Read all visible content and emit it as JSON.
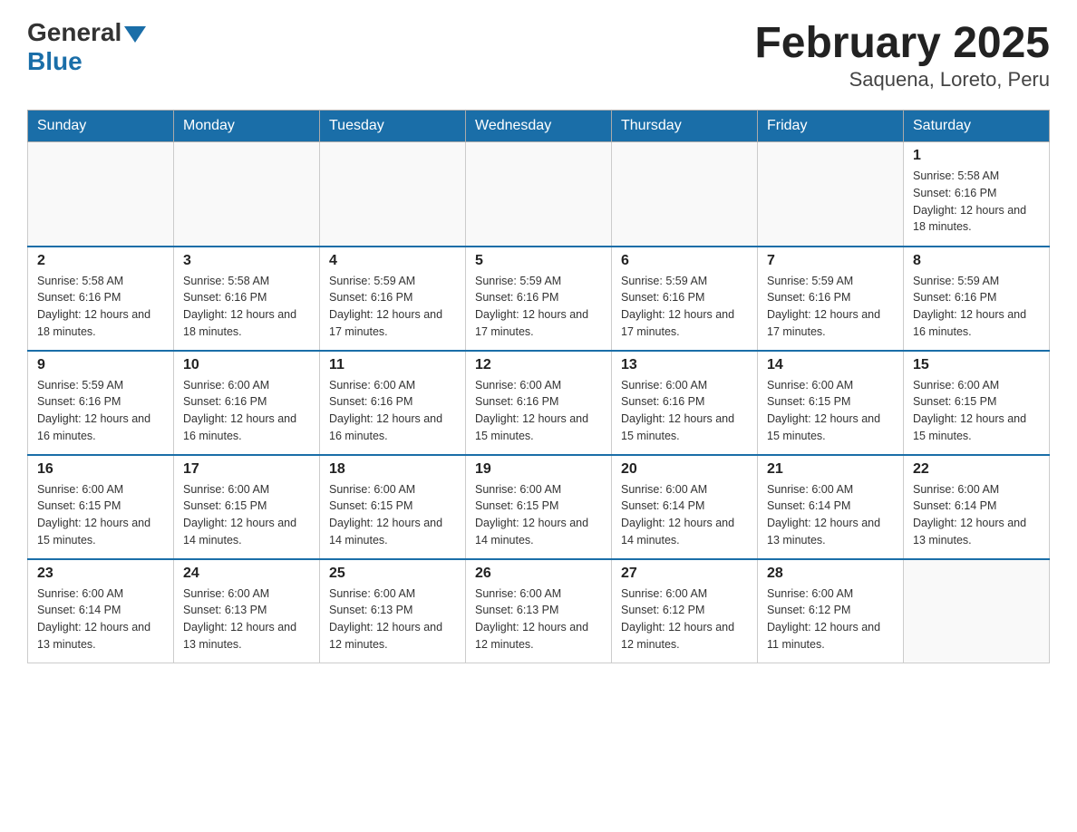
{
  "header": {
    "logo_general": "General",
    "logo_blue": "Blue",
    "month_title": "February 2025",
    "location": "Saquena, Loreto, Peru"
  },
  "days_of_week": [
    "Sunday",
    "Monday",
    "Tuesday",
    "Wednesday",
    "Thursday",
    "Friday",
    "Saturday"
  ],
  "weeks": [
    [
      {
        "day": "",
        "info": ""
      },
      {
        "day": "",
        "info": ""
      },
      {
        "day": "",
        "info": ""
      },
      {
        "day": "",
        "info": ""
      },
      {
        "day": "",
        "info": ""
      },
      {
        "day": "",
        "info": ""
      },
      {
        "day": "1",
        "info": "Sunrise: 5:58 AM\nSunset: 6:16 PM\nDaylight: 12 hours and 18 minutes."
      }
    ],
    [
      {
        "day": "2",
        "info": "Sunrise: 5:58 AM\nSunset: 6:16 PM\nDaylight: 12 hours and 18 minutes."
      },
      {
        "day": "3",
        "info": "Sunrise: 5:58 AM\nSunset: 6:16 PM\nDaylight: 12 hours and 18 minutes."
      },
      {
        "day": "4",
        "info": "Sunrise: 5:59 AM\nSunset: 6:16 PM\nDaylight: 12 hours and 17 minutes."
      },
      {
        "day": "5",
        "info": "Sunrise: 5:59 AM\nSunset: 6:16 PM\nDaylight: 12 hours and 17 minutes."
      },
      {
        "day": "6",
        "info": "Sunrise: 5:59 AM\nSunset: 6:16 PM\nDaylight: 12 hours and 17 minutes."
      },
      {
        "day": "7",
        "info": "Sunrise: 5:59 AM\nSunset: 6:16 PM\nDaylight: 12 hours and 17 minutes."
      },
      {
        "day": "8",
        "info": "Sunrise: 5:59 AM\nSunset: 6:16 PM\nDaylight: 12 hours and 16 minutes."
      }
    ],
    [
      {
        "day": "9",
        "info": "Sunrise: 5:59 AM\nSunset: 6:16 PM\nDaylight: 12 hours and 16 minutes."
      },
      {
        "day": "10",
        "info": "Sunrise: 6:00 AM\nSunset: 6:16 PM\nDaylight: 12 hours and 16 minutes."
      },
      {
        "day": "11",
        "info": "Sunrise: 6:00 AM\nSunset: 6:16 PM\nDaylight: 12 hours and 16 minutes."
      },
      {
        "day": "12",
        "info": "Sunrise: 6:00 AM\nSunset: 6:16 PM\nDaylight: 12 hours and 15 minutes."
      },
      {
        "day": "13",
        "info": "Sunrise: 6:00 AM\nSunset: 6:16 PM\nDaylight: 12 hours and 15 minutes."
      },
      {
        "day": "14",
        "info": "Sunrise: 6:00 AM\nSunset: 6:15 PM\nDaylight: 12 hours and 15 minutes."
      },
      {
        "day": "15",
        "info": "Sunrise: 6:00 AM\nSunset: 6:15 PM\nDaylight: 12 hours and 15 minutes."
      }
    ],
    [
      {
        "day": "16",
        "info": "Sunrise: 6:00 AM\nSunset: 6:15 PM\nDaylight: 12 hours and 15 minutes."
      },
      {
        "day": "17",
        "info": "Sunrise: 6:00 AM\nSunset: 6:15 PM\nDaylight: 12 hours and 14 minutes."
      },
      {
        "day": "18",
        "info": "Sunrise: 6:00 AM\nSunset: 6:15 PM\nDaylight: 12 hours and 14 minutes."
      },
      {
        "day": "19",
        "info": "Sunrise: 6:00 AM\nSunset: 6:15 PM\nDaylight: 12 hours and 14 minutes."
      },
      {
        "day": "20",
        "info": "Sunrise: 6:00 AM\nSunset: 6:14 PM\nDaylight: 12 hours and 14 minutes."
      },
      {
        "day": "21",
        "info": "Sunrise: 6:00 AM\nSunset: 6:14 PM\nDaylight: 12 hours and 13 minutes."
      },
      {
        "day": "22",
        "info": "Sunrise: 6:00 AM\nSunset: 6:14 PM\nDaylight: 12 hours and 13 minutes."
      }
    ],
    [
      {
        "day": "23",
        "info": "Sunrise: 6:00 AM\nSunset: 6:14 PM\nDaylight: 12 hours and 13 minutes."
      },
      {
        "day": "24",
        "info": "Sunrise: 6:00 AM\nSunset: 6:13 PM\nDaylight: 12 hours and 13 minutes."
      },
      {
        "day": "25",
        "info": "Sunrise: 6:00 AM\nSunset: 6:13 PM\nDaylight: 12 hours and 12 minutes."
      },
      {
        "day": "26",
        "info": "Sunrise: 6:00 AM\nSunset: 6:13 PM\nDaylight: 12 hours and 12 minutes."
      },
      {
        "day": "27",
        "info": "Sunrise: 6:00 AM\nSunset: 6:12 PM\nDaylight: 12 hours and 12 minutes."
      },
      {
        "day": "28",
        "info": "Sunrise: 6:00 AM\nSunset: 6:12 PM\nDaylight: 12 hours and 11 minutes."
      },
      {
        "day": "",
        "info": ""
      }
    ]
  ]
}
